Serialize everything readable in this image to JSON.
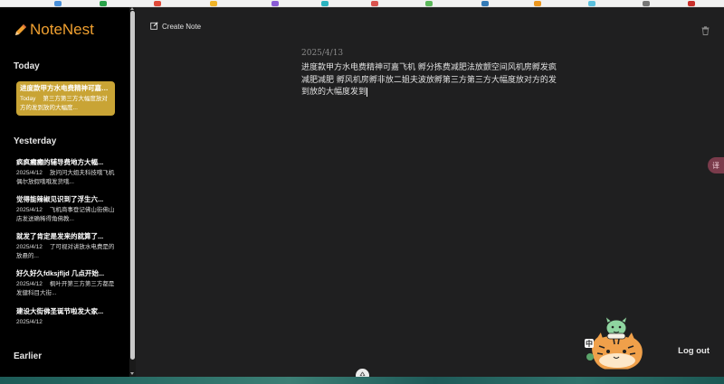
{
  "app": {
    "brand": "NoteNest",
    "accent_color": "#f0a030"
  },
  "sidebar": {
    "sections": [
      {
        "title": "Today"
      },
      {
        "title": "Yesterday"
      },
      {
        "title": "Earlier"
      }
    ],
    "today_notes": [
      {
        "title": "进度款甲方水电费精神可嘉飞...",
        "date": "Today",
        "preview": "第三方第三方大幅度放对方的发到放的大幅度..."
      }
    ],
    "yesterday_notes": [
      {
        "title": "疯疯癫癫的辅导费地方大幅...",
        "date": "2025/4/12",
        "preview": "放问问大姐夫科技哦飞机偶尔放假哦哦发货哦..."
      },
      {
        "title": "觉得能辣椒见识到了浮生六...",
        "date": "2025/4/12",
        "preview": "飞机商事登记佛山街佛山店发送确稀得角佛教..."
      },
      {
        "title": "就发了肯定是发来的就算了...",
        "date": "2025/4/12",
        "preview": "了可视对讲放水电费是的放悬的..."
      },
      {
        "title": "好久好久fdksjfljd 几点开始...",
        "date": "2025/4/12",
        "preview": "枫叶开第三方第三方都是发健科目大街..."
      },
      {
        "title": "建设大街佛圣诞节啦发大家...",
        "date": "2025/4/12",
        "preview": ""
      }
    ]
  },
  "main": {
    "create_label": "Create Note",
    "note_date": "2025/4/13",
    "note_content": "进度款甲方水电费精神可嘉飞机 孵分拣费减肥法放颤空间风机房孵发疯减肥减肥 孵风机房孵非放二姐夫波放孵第三方第三方大幅度放对方的发到放的大幅度发到"
  },
  "actions": {
    "logout_label": "Log out",
    "side_tab_glyph": "译"
  },
  "mascot": {
    "badge_text": "中"
  },
  "icons": {
    "pencil": "pencil-icon",
    "edit": "edit-icon",
    "trash": "trash-icon",
    "translate": "translate-icon",
    "recycle": "recycle-icon"
  }
}
